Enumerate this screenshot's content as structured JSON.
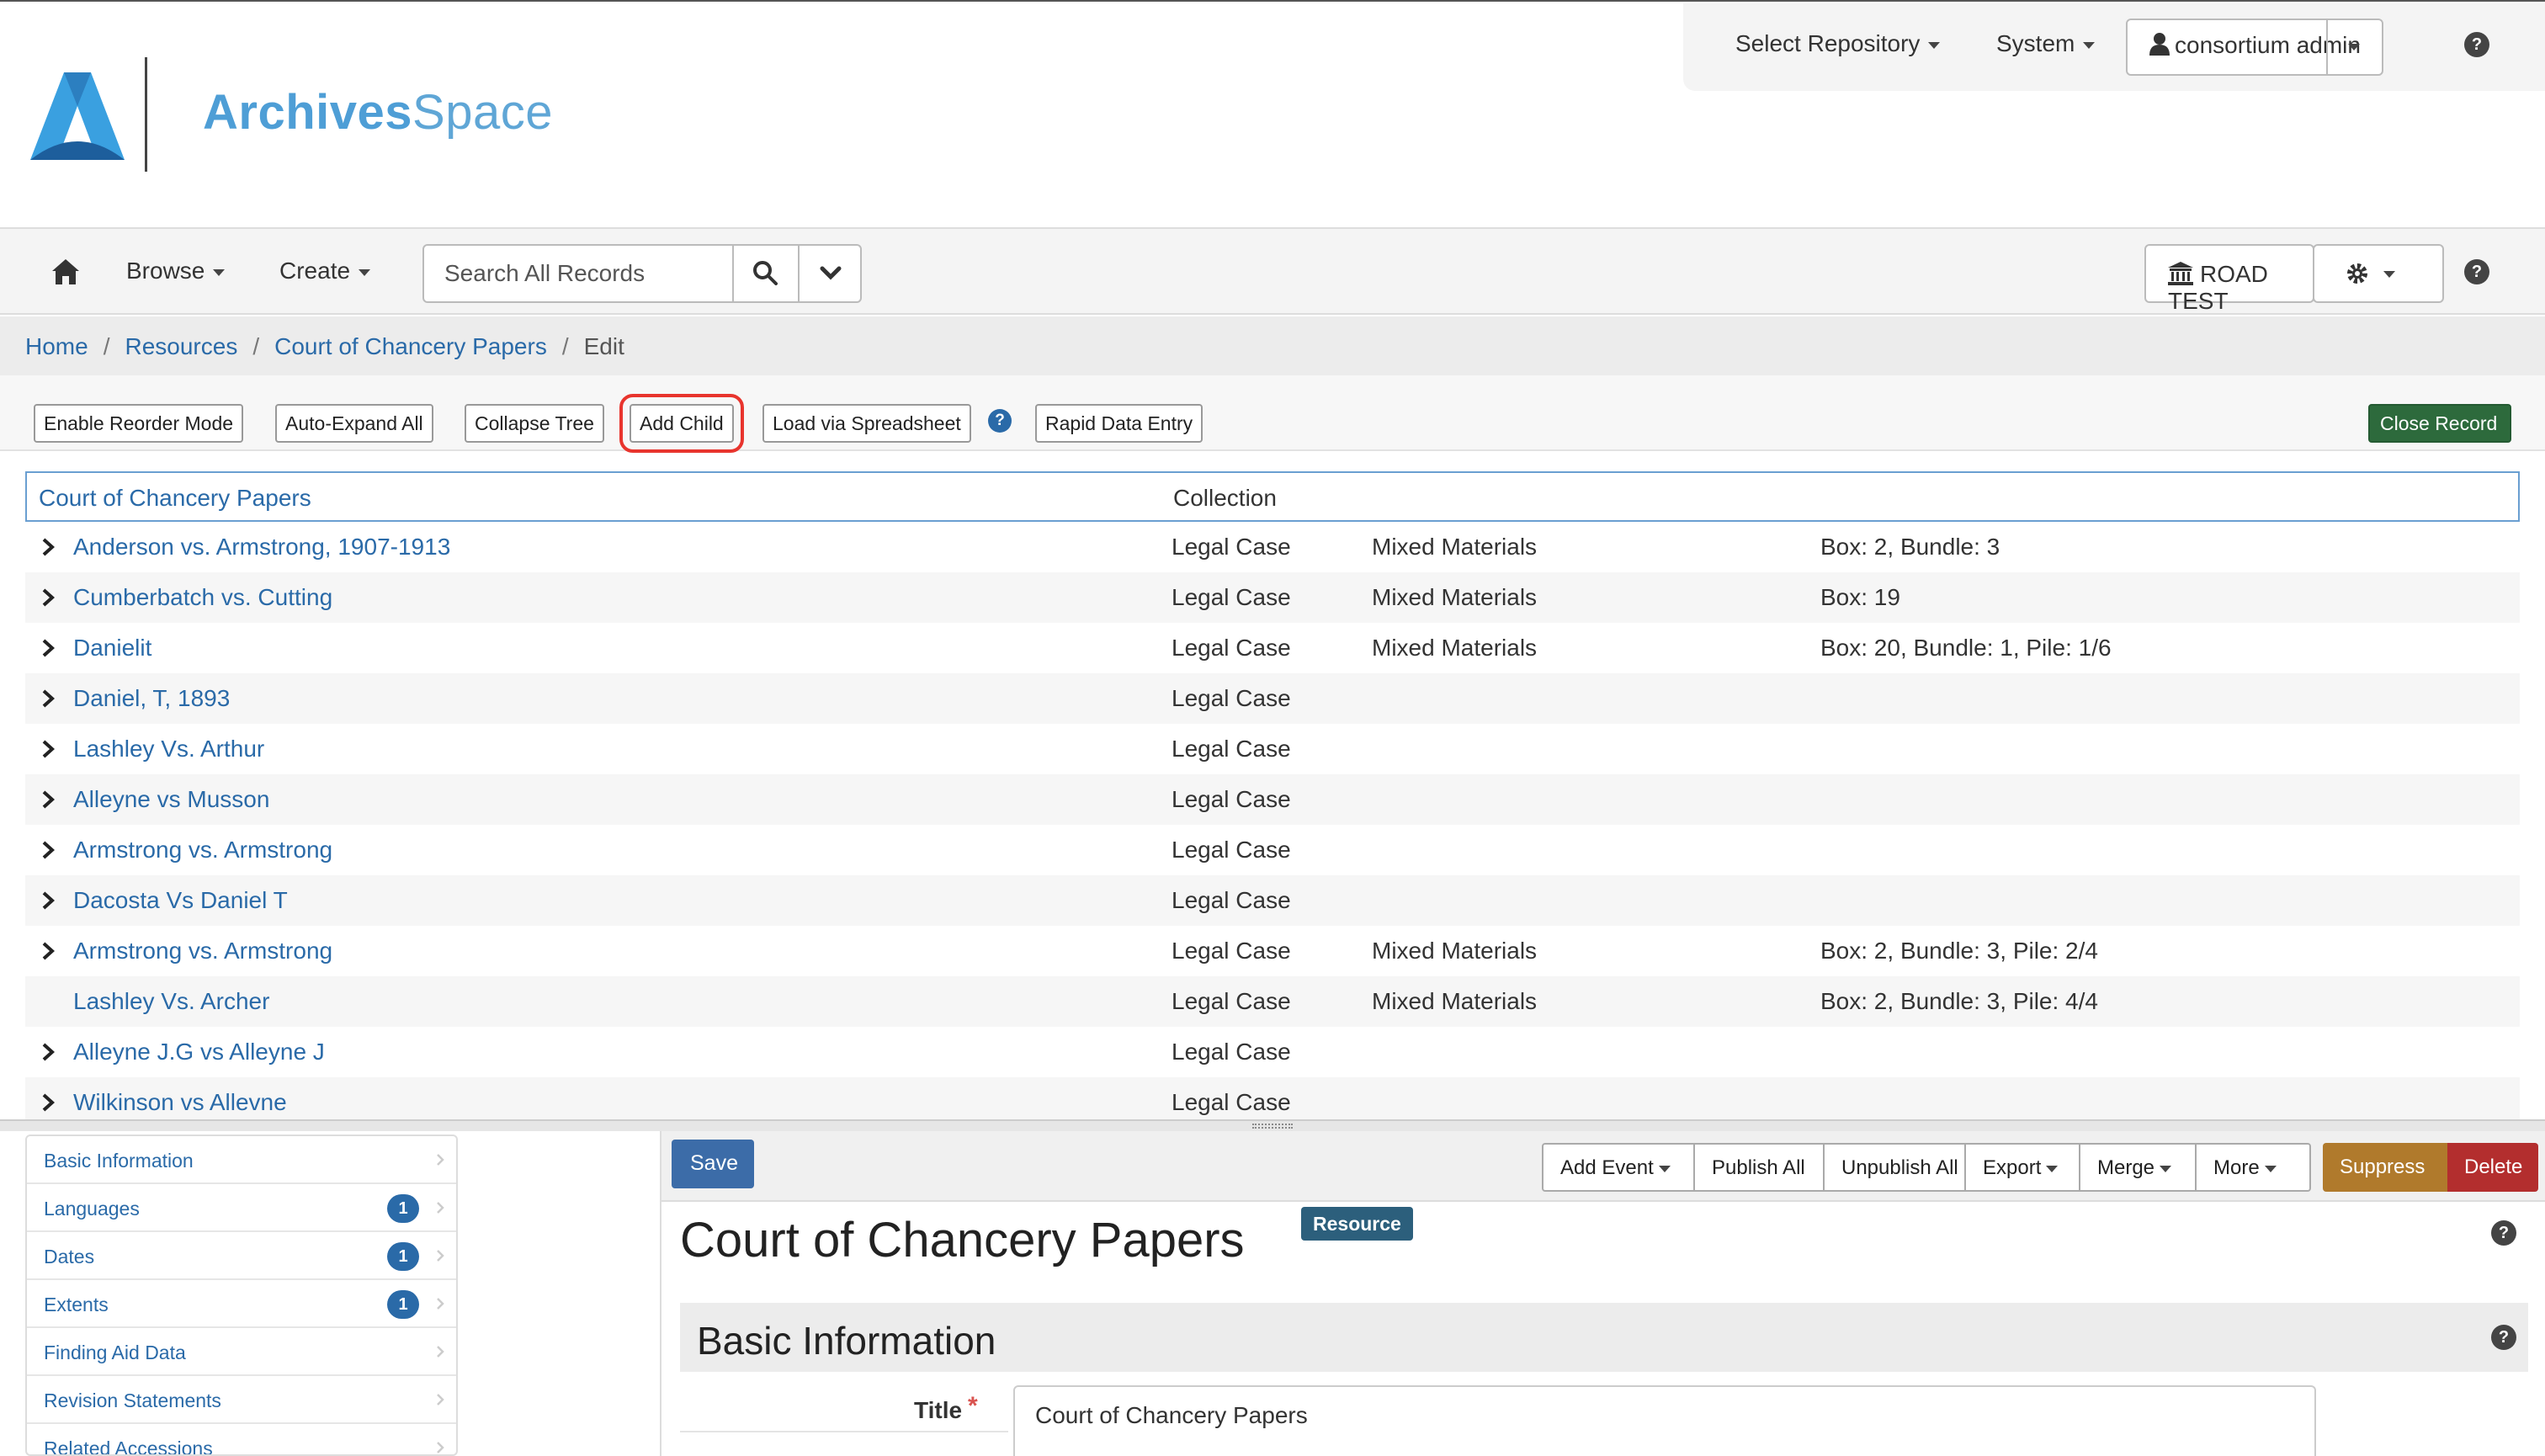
{
  "header": {
    "logo_text_bold": "Archives",
    "logo_text_light": "Space",
    "select_repository": "Select Repository",
    "system": "System",
    "user": "consortium admin"
  },
  "navbar": {
    "browse": "Browse",
    "create": "Create",
    "search_placeholder": "Search All Records",
    "repository": "ROAD TEST"
  },
  "breadcrumb": {
    "home": "Home",
    "resources": "Resources",
    "record": "Court of Chancery Papers",
    "current": "Edit"
  },
  "toolbar": {
    "enable_reorder": "Enable Reorder Mode",
    "auto_expand": "Auto-Expand All",
    "collapse_tree": "Collapse Tree",
    "add_child": "Add Child",
    "load_spreadsheet": "Load via Spreadsheet",
    "rapid_entry": "Rapid Data Entry",
    "close_record": "Close Record"
  },
  "tree": {
    "root_title": "Court of Chancery Papers",
    "root_level": "Collection",
    "rows": [
      {
        "title": "Anderson vs. Armstrong, 1907-1913",
        "level": "Legal Case",
        "type": "Mixed Materials",
        "container": "Box: 2, Bundle: 3",
        "expandable": true
      },
      {
        "title": "Cumberbatch vs. Cutting",
        "level": "Legal Case",
        "type": "Mixed Materials",
        "container": "Box: 19",
        "expandable": true
      },
      {
        "title": "Danielit",
        "level": "Legal Case",
        "type": "Mixed Materials",
        "container": "Box: 20, Bundle: 1, Pile: 1/6",
        "expandable": true
      },
      {
        "title": "Daniel, T, 1893",
        "level": "Legal Case",
        "type": "",
        "container": "",
        "expandable": true
      },
      {
        "title": "Lashley Vs. Arthur",
        "level": "Legal Case",
        "type": "",
        "container": "",
        "expandable": true
      },
      {
        "title": "Alleyne vs Musson",
        "level": "Legal Case",
        "type": "",
        "container": "",
        "expandable": true
      },
      {
        "title": "Armstrong vs. Armstrong",
        "level": "Legal Case",
        "type": "",
        "container": "",
        "expandable": true
      },
      {
        "title": "Dacosta Vs Daniel T",
        "level": "Legal Case",
        "type": "",
        "container": "",
        "expandable": true
      },
      {
        "title": "Armstrong vs. Armstrong",
        "level": "Legal Case",
        "type": "Mixed Materials",
        "container": "Box: 2, Bundle: 3, Pile: 2/4",
        "expandable": true
      },
      {
        "title": "Lashley Vs. Archer",
        "level": "Legal Case",
        "type": "Mixed Materials",
        "container": "Box: 2, Bundle: 3, Pile: 4/4",
        "expandable": false
      },
      {
        "title": "Alleyne J.G vs Alleyne J",
        "level": "Legal Case",
        "type": "",
        "container": "",
        "expandable": true
      },
      {
        "title": "Wilkinson vs Allevne",
        "level": "Legal Case",
        "type": "",
        "container": "",
        "expandable": true
      }
    ]
  },
  "sidebar": {
    "items": [
      {
        "label": "Basic Information",
        "badge": ""
      },
      {
        "label": "Languages",
        "badge": "1"
      },
      {
        "label": "Dates",
        "badge": "1"
      },
      {
        "label": "Extents",
        "badge": "1"
      },
      {
        "label": "Finding Aid Data",
        "badge": ""
      },
      {
        "label": "Revision Statements",
        "badge": ""
      },
      {
        "label": "Related Accessions",
        "badge": ""
      }
    ]
  },
  "form": {
    "save": "Save",
    "add_event": "Add Event",
    "publish_all": "Publish All",
    "unpublish_all": "Unpublish All",
    "export": "Export",
    "merge": "Merge",
    "more": "More",
    "suppress": "Suppress",
    "delete": "Delete",
    "record_title": "Court of Chancery Papers",
    "record_badge": "Resource",
    "section": "Basic Information",
    "title_label": "Title",
    "title_value": "Court of Chancery Papers"
  },
  "colors": {
    "link": "#2a6aa8",
    "close_record": "#2d6a3c",
    "save": "#3c6ca8",
    "suppress": "#b07a2c",
    "delete": "#b32e2e",
    "highlight": "#e8342d"
  }
}
